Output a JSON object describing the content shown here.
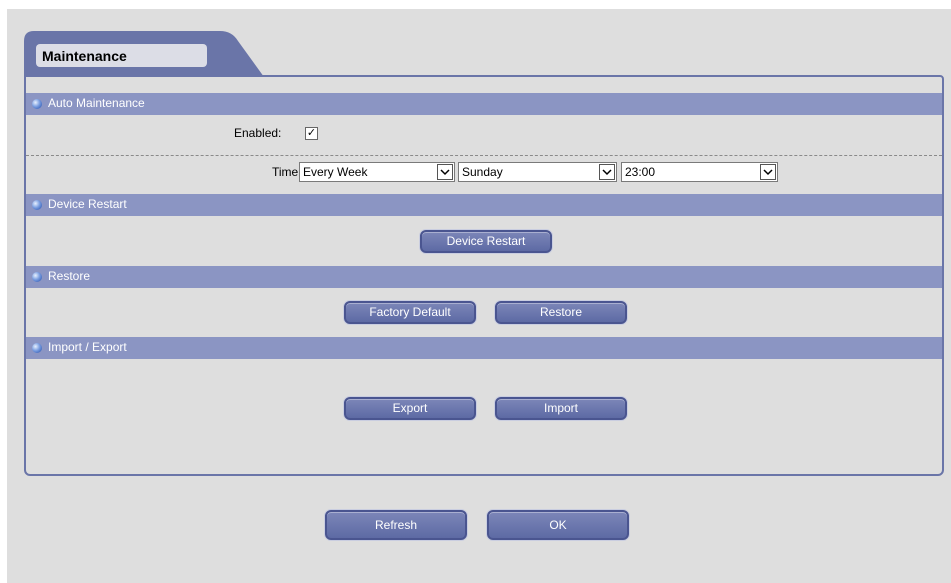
{
  "tab": {
    "title": "Maintenance"
  },
  "sections": {
    "auto_maintenance": {
      "title": "Auto Maintenance",
      "enabled_label": "Enabled:",
      "enabled_mark": "✓",
      "time_label": "Time:",
      "frequency": "Every Week",
      "day": "Sunday",
      "hour": "23:00"
    },
    "device_restart": {
      "title": "Device Restart",
      "button": "Device Restart"
    },
    "restore": {
      "title": "Restore",
      "factory_default_button": "Factory Default",
      "restore_button": "Restore"
    },
    "import_export": {
      "title": "Import / Export",
      "export_button": "Export",
      "import_button": "Import"
    }
  },
  "footer": {
    "refresh_button": "Refresh",
    "ok_button": "OK"
  },
  "colors": {
    "section_header": "#8b95c3",
    "panel_border": "#6a75a8",
    "button": "#6a75ad",
    "background": "#dedede"
  }
}
